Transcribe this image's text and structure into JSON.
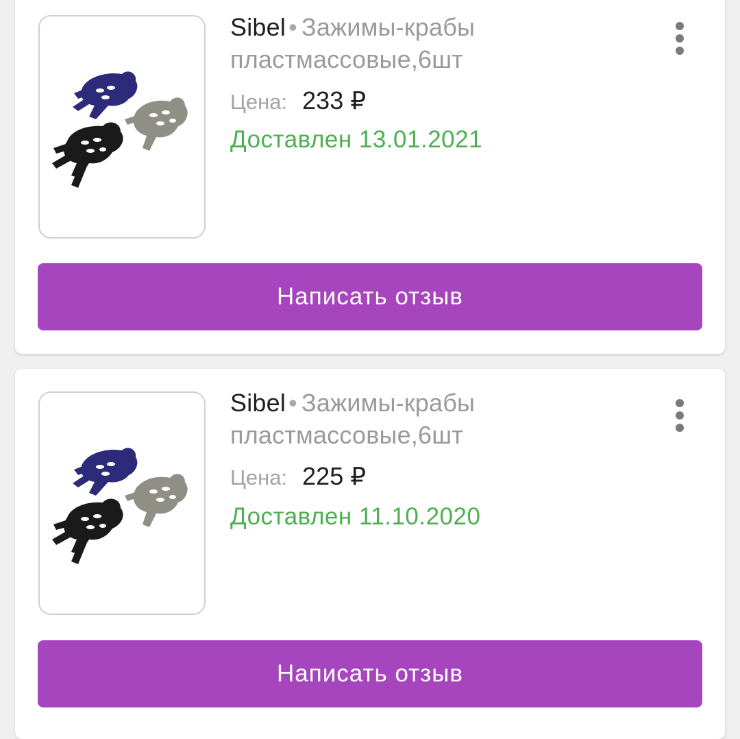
{
  "orders": [
    {
      "brand": "Sibel",
      "separator": "•",
      "product_name": "Зажимы-крабы пластмассовые,6шт",
      "price_label": "Цена:",
      "price": "233 ₽",
      "status": "Доставлен 13.01.2021",
      "review_button": "Написать отзыв",
      "menu_icon": "more-vertical-icon",
      "image_icon": "hair-claw-clips-image"
    },
    {
      "brand": "Sibel",
      "separator": "•",
      "product_name": "Зажимы-крабы пластмассовые,6шт",
      "price_label": "Цена:",
      "price": "225 ₽",
      "status": "Доставлен 11.10.2020",
      "review_button": "Написать отзыв",
      "menu_icon": "more-vertical-icon",
      "image_icon": "hair-claw-clips-image"
    }
  ],
  "colors": {
    "accent_button": "#a645bd",
    "delivered_status": "#4caf50",
    "clip_blue": "#2e2a7a",
    "clip_black": "#1a1a1a",
    "clip_grey": "#8f8f86"
  }
}
